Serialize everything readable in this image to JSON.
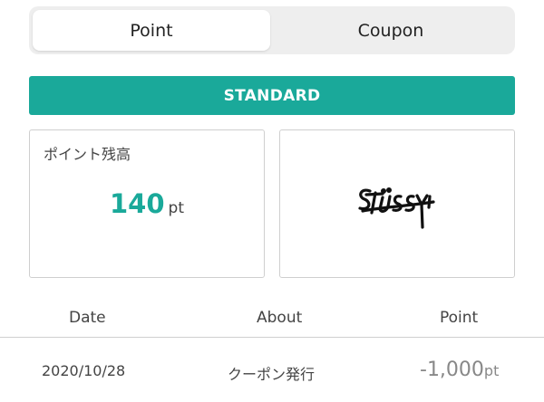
{
  "tabs": {
    "point_label": "Point",
    "coupon_label": "Coupon"
  },
  "tier": {
    "label": "STANDARD",
    "color": "#1aa99a"
  },
  "balance": {
    "label": "ポイント残高",
    "value": "140",
    "unit": "pt",
    "value_color": "#1aa99a"
  },
  "brand": {
    "logo_text": "Stüssy"
  },
  "history": {
    "headers": {
      "date": "Date",
      "about": "About",
      "point": "Point"
    },
    "rows": [
      {
        "date": "2020/10/28",
        "about": "クーポン発行",
        "point": "-1,000",
        "unit": "pt"
      }
    ]
  }
}
